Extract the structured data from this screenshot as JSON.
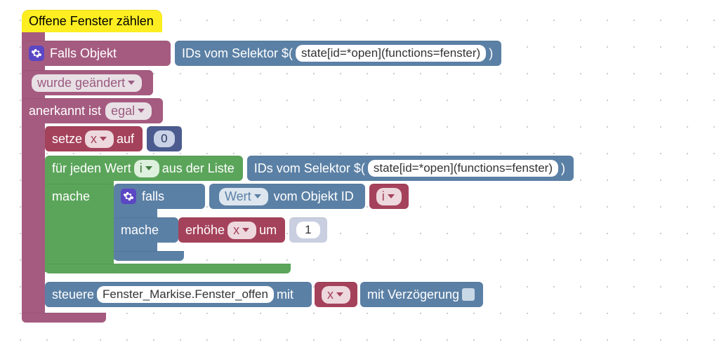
{
  "title": "Offene Fenster zählen",
  "trigger": {
    "if_object": "Falls Objekt",
    "selector_label": "IDs vom Selektor $(",
    "selector_value": "state[id=*open](functions=fenster)",
    "selector_close": ")",
    "was_changed": "wurde geändert",
    "ack_label": "anerkannt ist",
    "ack_value": "egal"
  },
  "set": {
    "label": "setze",
    "var": "x",
    "to": "auf",
    "val": "0"
  },
  "loop": {
    "for_each": "für jeden Wert",
    "var": "i",
    "from_list": "aus der Liste",
    "do": "mache",
    "selector_label": "IDs vom Selektor $(",
    "selector_value": "state[id=*open](functions=fenster)",
    "selector_close": ")",
    "if": "falls",
    "value": "Wert",
    "of_obj": "vom Objekt ID",
    "obj_var": "i",
    "inc": "erhöhe",
    "inc_var": "x",
    "by": "um",
    "by_val": "1"
  },
  "steer": {
    "label": "steuere",
    "target": "Fenster_Markise.Fenster_offen",
    "with": "mit",
    "var": "x",
    "delay": "mit Verzögerung"
  }
}
